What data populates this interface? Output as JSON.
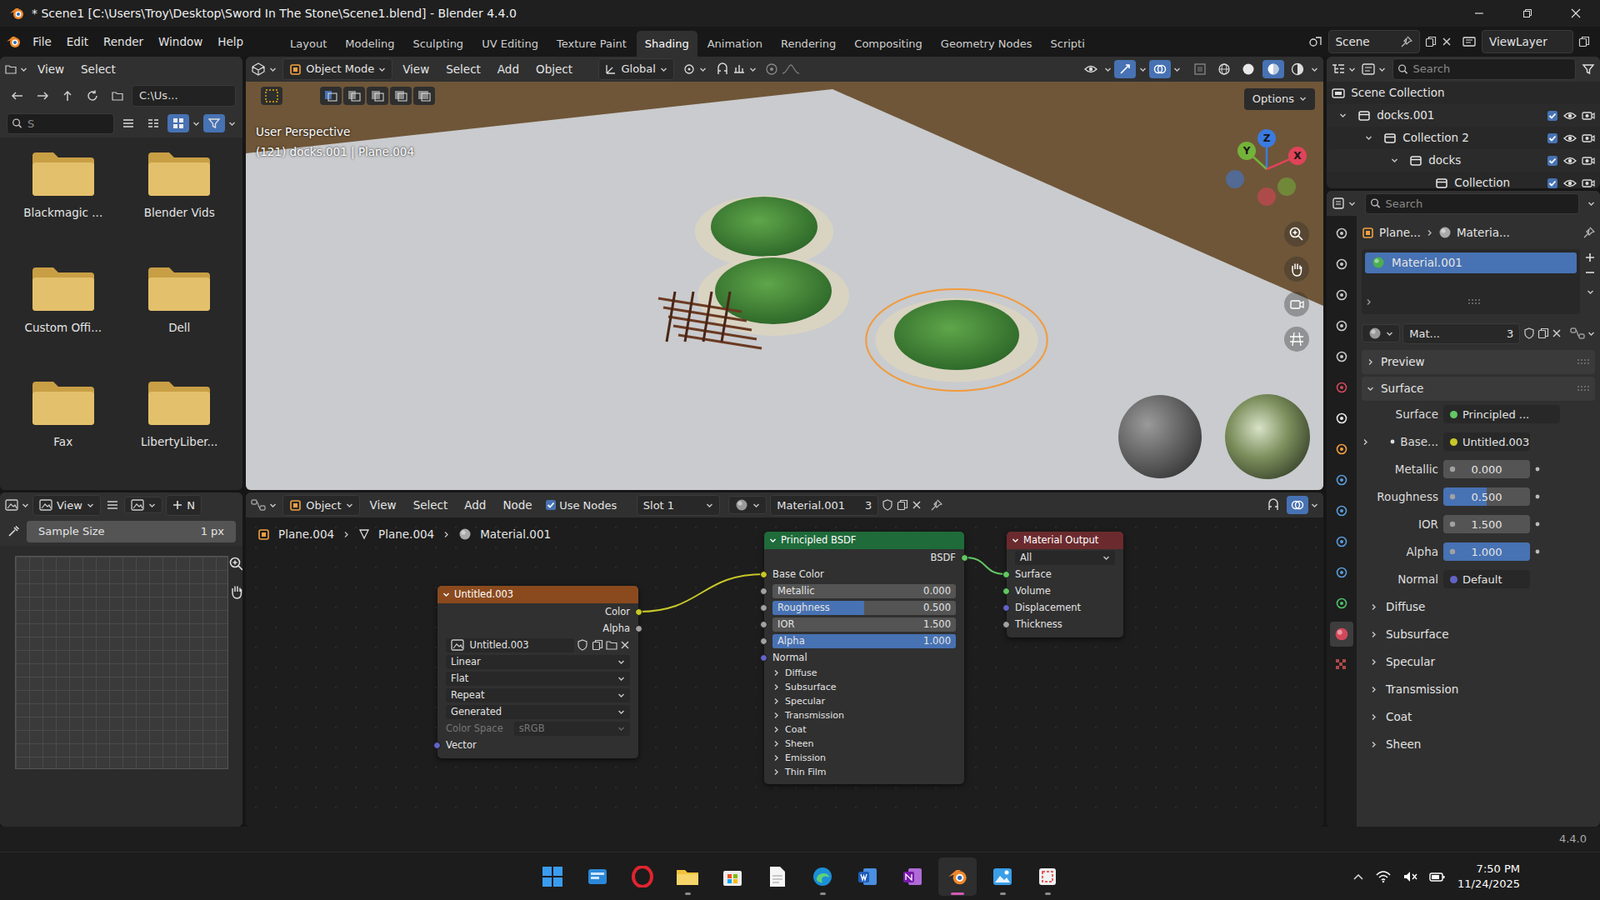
{
  "window": {
    "title": "* Scene1 [C:\\Users\\Troy\\Desktop\\Sword In The Stone\\Scene1.blend] - Blender 4.4.0"
  },
  "menu": [
    "File",
    "Edit",
    "Render",
    "Window",
    "Help"
  ],
  "workspaces": [
    {
      "label": "Layout",
      "selected": false
    },
    {
      "label": "Modeling",
      "selected": false
    },
    {
      "label": "Sculpting",
      "selected": false
    },
    {
      "label": "UV Editing",
      "selected": false
    },
    {
      "label": "Texture Paint",
      "selected": false
    },
    {
      "label": "Shading",
      "selected": true
    },
    {
      "label": "Animation",
      "selected": false
    },
    {
      "label": "Rendering",
      "selected": false
    },
    {
      "label": "Compositing",
      "selected": false
    },
    {
      "label": "Geometry Nodes",
      "selected": false
    },
    {
      "label": "Scripti",
      "selected": false
    }
  ],
  "scene": "Scene",
  "view_layer": "ViewLayer",
  "file_browser": {
    "menu": [
      "View",
      "Select"
    ],
    "path": "C:\\Us...",
    "search": {
      "placeholder": "S"
    },
    "display": [
      {
        "selected": false
      },
      {
        "selected": false
      },
      {
        "selected": true
      }
    ],
    "filter": {
      "on": true
    },
    "folders": [
      "Blackmagic ...",
      "Blender Vids",
      "Custom Offi...",
      "Dell",
      "Fax",
      "LibertyLiber..."
    ]
  },
  "image_editor": {
    "menu": [
      "View"
    ],
    "new_button": "N",
    "sample_size": {
      "label": "Sample Size",
      "value": "1 px"
    }
  },
  "viewport": {
    "mode": "Object Mode",
    "menu": [
      "View",
      "Select",
      "Add",
      "Object"
    ],
    "orientation": "Global",
    "toggles": [
      {
        "on": true
      },
      {
        "on": true
      }
    ],
    "shading": [
      {
        "selected": false
      },
      {
        "selected": false
      },
      {
        "selected": true
      },
      {
        "selected": false
      }
    ],
    "options": "Options",
    "info": [
      "User Perspective",
      "(121) docks.001 | Plane.004"
    ],
    "axes": [
      {
        "label": "Z",
        "color": "#3b7be0"
      },
      {
        "label": "Y",
        "color": "#73b33a"
      },
      {
        "label": "X",
        "color": "#e0435a"
      }
    ],
    "objects": [
      {
        "kind": "island",
        "selected": false
      },
      {
        "kind": "island",
        "selected": false
      },
      {
        "kind": "docks",
        "selected": false
      },
      {
        "kind": "island",
        "selected": true
      }
    ]
  },
  "node_editor": {
    "mode": "Object",
    "menu": [
      "View",
      "Select",
      "Add",
      "Node"
    ],
    "use_nodes": {
      "label": "Use Nodes",
      "checked": true
    },
    "slot": "Slot 1",
    "material": "Material.001",
    "users": "3",
    "breadcrumb": [
      "Plane.004",
      "Plane.004",
      "Material.001"
    ],
    "nodes": [
      {
        "title": "Untitled.003",
        "kind": "image",
        "color": "#8a4a1e",
        "outputs": [
          {
            "label": "Color",
            "color": "#c7c729"
          },
          {
            "label": "Alpha",
            "color": "#a1a1a1"
          }
        ],
        "image": "Untitled.003",
        "options": [
          "Linear",
          "Flat",
          "Repeat",
          "Generated"
        ],
        "color_space": {
          "label": "Color Space",
          "value": "sRGB",
          "disabled": true
        },
        "inputs": [
          {
            "label": "Vector",
            "kind": "socket",
            "color": "#6363c7"
          }
        ]
      },
      {
        "title": "Principled BSDF",
        "kind": "bsdf",
        "color": "#1f6b3a",
        "outputs": [
          {
            "label": "BSDF",
            "color": "#63c763"
          }
        ],
        "inputs": [
          {
            "label": "Base Color",
            "kind": "socket",
            "color": "#c7c729"
          },
          {
            "label": "Metallic",
            "kind": "slider",
            "value": "0.000",
            "level": 0,
            "color": "#a1a1a1"
          },
          {
            "label": "Roughness",
            "kind": "slider",
            "value": "0.500",
            "level": 0.5,
            "color": "#a1a1a1"
          },
          {
            "label": "IOR",
            "kind": "number",
            "value": "1.500",
            "color": "#a1a1a1"
          },
          {
            "label": "Alpha",
            "kind": "slider",
            "value": "1.000",
            "level": 1,
            "color": "#a1a1a1"
          },
          {
            "label": "Normal",
            "kind": "socket",
            "color": "#6363c7"
          }
        ],
        "panels": [
          "Diffuse",
          "Subsurface",
          "Specular",
          "Transmission",
          "Coat",
          "Sheen",
          "Emission",
          "Thin Film"
        ]
      },
      {
        "title": "Material Output",
        "kind": "output",
        "color": "#6b2a2e",
        "target": "All",
        "outputs": [],
        "inputs": [
          {
            "label": "Surface",
            "kind": "socket",
            "color": "#63c763"
          },
          {
            "label": "Volume",
            "kind": "socket",
            "color": "#63c763"
          },
          {
            "label": "Displacement",
            "kind": "socket",
            "color": "#6363c7"
          },
          {
            "label": "Thickness",
            "kind": "socket",
            "color": "#a1a1a1"
          }
        ]
      }
    ],
    "links": [
      {
        "from_node": 0,
        "from_socket": 0,
        "to_node": 1,
        "to_socket": 0,
        "color": "#c7c729"
      },
      {
        "from_node": 1,
        "from_socket": 0,
        "to_node": 2,
        "to_socket": 0,
        "color": "#63c763"
      }
    ]
  },
  "outliner": {
    "search": {
      "placeholder": "Search"
    },
    "items": [
      {
        "name": "Scene Collection",
        "depth": 0,
        "kind": "scene"
      },
      {
        "name": "docks.001",
        "depth": 1,
        "kind": "collection",
        "expanded": true,
        "checked": true,
        "visible": true,
        "renderable": true
      },
      {
        "name": "Collection 2",
        "depth": 2,
        "kind": "collection",
        "expanded": true,
        "checked": true,
        "visible": true,
        "renderable": true
      },
      {
        "name": "docks",
        "depth": 3,
        "kind": "collection",
        "expanded": true,
        "checked": true,
        "visible": true,
        "renderable": true
      },
      {
        "name": "Collection",
        "depth": 4,
        "kind": "collection",
        "checked": true,
        "visible": true,
        "renderable": true
      }
    ]
  },
  "properties": {
    "search": {
      "placeholder": "Search"
    },
    "tabs": [
      {
        "selected": false
      },
      {
        "selected": false
      },
      {
        "selected": false
      },
      {
        "selected": false
      },
      {
        "selected": false
      },
      {
        "selected": false
      },
      {
        "selected": false
      },
      {
        "selected": false
      },
      {
        "selected": false
      },
      {
        "selected": false
      },
      {
        "selected": false
      },
      {
        "selected": false
      },
      {
        "selected": false
      },
      {
        "selected": true
      },
      {
        "selected": false
      }
    ],
    "breadcrumb": [
      "Plane...",
      "Materia..."
    ],
    "slots": [
      {
        "name": "Material.001",
        "selected": true
      }
    ],
    "material": {
      "name": "Mat...",
      "users": "3"
    },
    "sections": [
      {
        "label": "Preview",
        "expanded": false
      },
      {
        "label": "Surface",
        "expanded": true
      }
    ],
    "surface": {
      "label": "Surface",
      "value": "Principled ...",
      "color": "#63c763"
    },
    "fields": [
      {
        "label": "Base...",
        "value": "Untitled.003",
        "kind": "link",
        "color": "#c7c729",
        "expanded": false
      },
      {
        "label": "Metallic",
        "value": "0.000",
        "kind": "slider",
        "level": 0
      },
      {
        "label": "Roughness",
        "value": "0.500",
        "kind": "slider",
        "level": 0.5
      },
      {
        "label": "IOR",
        "value": "1.500",
        "kind": "number"
      },
      {
        "label": "Alpha",
        "value": "1.000",
        "kind": "slider",
        "level": 1
      },
      {
        "label": "Normal",
        "value": "Default",
        "kind": "link",
        "color": "#6363c7"
      }
    ],
    "subpanels": [
      "Diffuse",
      "Subsurface",
      "Specular",
      "Transmission",
      "Coat",
      "Sheen"
    ]
  },
  "status_bar": {
    "version": "4.4.0"
  },
  "taskbar": {
    "apps": [
      {
        "running": false,
        "active": false
      },
      {
        "running": false,
        "active": false
      },
      {
        "running": false,
        "active": false
      },
      {
        "running": true,
        "active": false
      },
      {
        "running": false,
        "active": false
      },
      {
        "running": false,
        "active": false
      },
      {
        "running": true,
        "active": false
      },
      {
        "running": false,
        "active": false
      },
      {
        "running": false,
        "active": false
      },
      {
        "running": true,
        "active": true
      },
      {
        "running": true,
        "active": false
      },
      {
        "running": true,
        "active": false
      }
    ],
    "time": "7:50 PM",
    "date": "11/24/2025"
  }
}
